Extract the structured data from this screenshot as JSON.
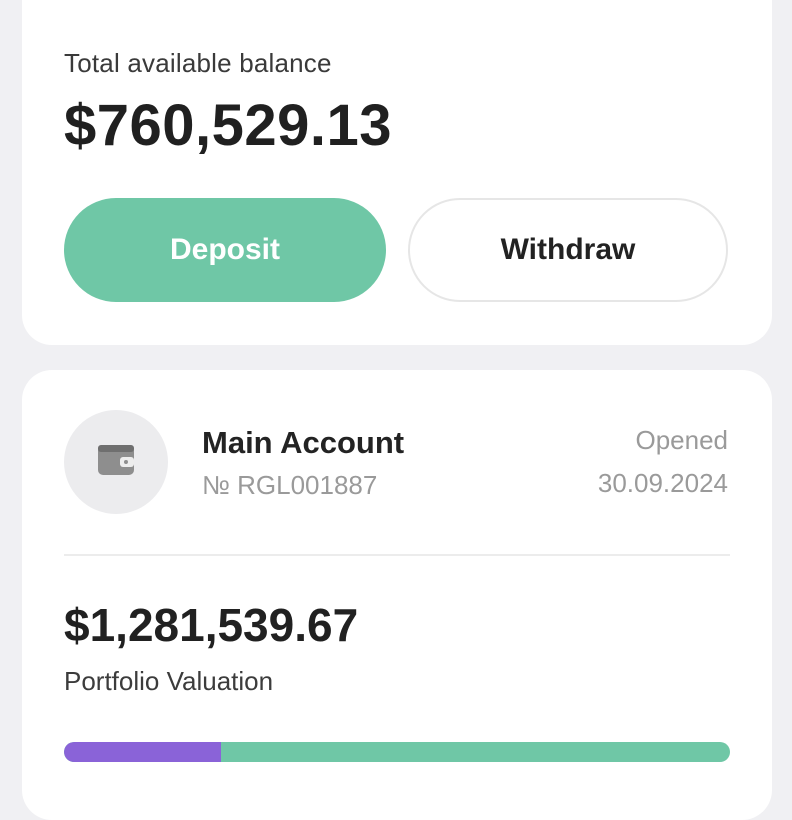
{
  "balance": {
    "label": "Total available balance",
    "amount": "$760,529.13"
  },
  "actions": {
    "deposit_label": "Deposit",
    "withdraw_label": "Withdraw"
  },
  "account": {
    "icon": "wallet-icon",
    "name": "Main Account",
    "number": "№ RGL001887",
    "opened_label": "Opened",
    "opened_date": "30.09.2024"
  },
  "portfolio": {
    "amount": "$1,281,539.67",
    "label": "Portfolio Valuation",
    "progress_fraction": 0.235
  },
  "colors": {
    "accent": "#6fc7a6",
    "progress_purple": "#8a63d8",
    "background": "#f0f0f3"
  }
}
